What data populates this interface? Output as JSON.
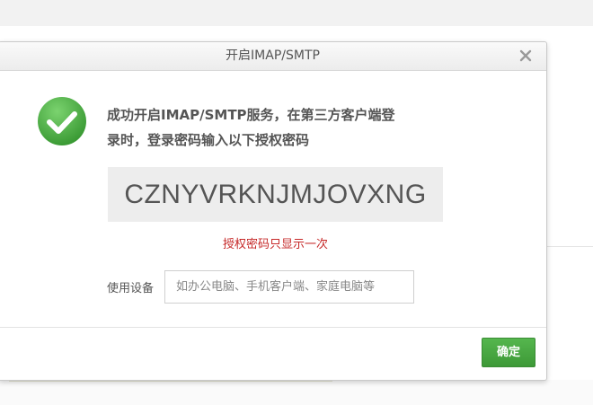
{
  "dialog": {
    "title": "开启IMAP/SMTP",
    "message_line1": "成功开启IMAP/SMTP服务，在第三方客户端登",
    "message_line2": "录时，登录密码输入以下授权密码",
    "auth_code": "CZNYVRKNJMJOVXNG",
    "notice": "授权密码只显示一次",
    "device_label": "使用设备",
    "device_placeholder": "如办公电脑、手机客户端、家庭电脑等",
    "device_value": "",
    "confirm_label": "确定",
    "icons": {
      "close": "close-icon",
      "success": "success-check-icon"
    },
    "colors": {
      "accent_green": "#4caf45",
      "notice_red": "#c62828"
    }
  }
}
